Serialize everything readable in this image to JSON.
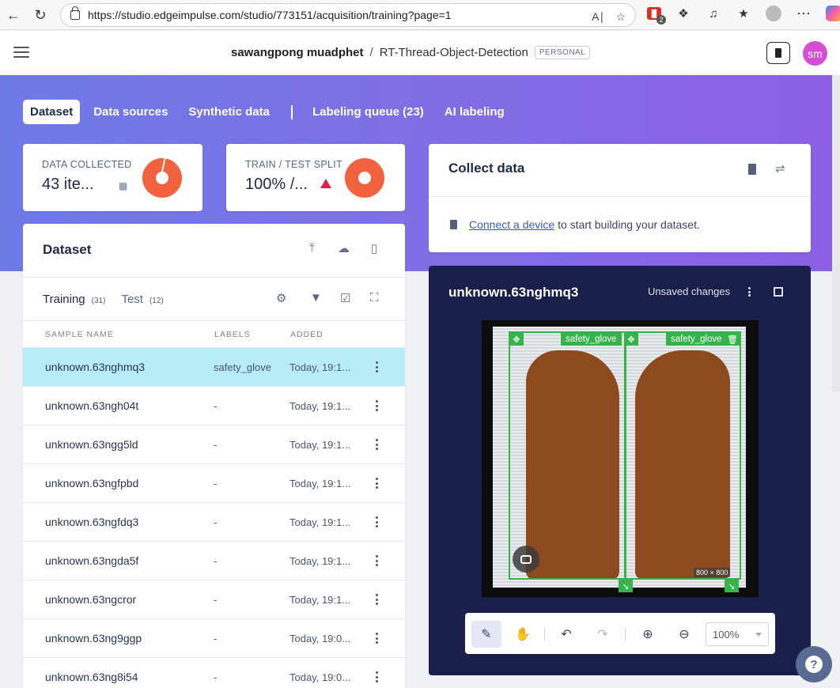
{
  "browser": {
    "url": "https://studio.edgeimpulse.com/studio/773151/acquisition/training?page=1",
    "ext_badge": "2"
  },
  "header": {
    "owner": "sawangpong muadphet",
    "separator": "/",
    "project": "RT-Thread-Object-Detection",
    "project_tag": "PERSONAL",
    "avatar_initials": "sm"
  },
  "tabs": [
    {
      "label": "Dataset",
      "active": true
    },
    {
      "label": "Data sources"
    },
    {
      "label": "Synthetic data"
    },
    {
      "label": "Labeling queue (23)"
    },
    {
      "label": "AI labeling"
    }
  ],
  "stats": {
    "collected": {
      "label": "DATA COLLECTED",
      "value": "43 ite..."
    },
    "split": {
      "label": "TRAIN / TEST SPLIT",
      "value": "100% /..."
    }
  },
  "collect": {
    "title": "Collect data",
    "link_text": "Connect a device",
    "rest_text": " to start building your dataset."
  },
  "dataset": {
    "title": "Dataset",
    "training_label": "Training",
    "training_count": "(31)",
    "test_label": "Test",
    "test_count": "(12)",
    "columns": [
      "SAMPLE NAME",
      "LABELS",
      "ADDED"
    ],
    "rows": [
      {
        "name": "unknown.63nghmq3",
        "label": "safety_glove",
        "added": "Today, 19:1...",
        "selected": true
      },
      {
        "name": "unknown.63ngh04t",
        "label": "-",
        "added": "Today, 19:1..."
      },
      {
        "name": "unknown.63ngg5ld",
        "label": "-",
        "added": "Today, 19:1..."
      },
      {
        "name": "unknown.63ngfpbd",
        "label": "-",
        "added": "Today, 19:1..."
      },
      {
        "name": "unknown.63ngfdq3",
        "label": "-",
        "added": "Today, 19:1..."
      },
      {
        "name": "unknown.63ngda5f",
        "label": "-",
        "added": "Today, 19:1..."
      },
      {
        "name": "unknown.63ngcror",
        "label": "-",
        "added": "Today, 19:1..."
      },
      {
        "name": "unknown.63ng9ggp",
        "label": "-",
        "added": "Today, 19:0..."
      },
      {
        "name": "unknown.63ng8i54",
        "label": "-",
        "added": "Today, 19:0..."
      }
    ]
  },
  "viewer": {
    "title": "unknown.63nghmq3",
    "status": "Unsaved changes",
    "box_labels": [
      "safety_glove",
      "safety_glove"
    ],
    "size_tag": "800 × 800",
    "zoom": "100%"
  },
  "colors": {
    "accent": "#7f6fe6",
    "selected_row": "#b8ecf7",
    "bbox": "#36b34a",
    "donut": "#f2623f",
    "viewer_bg": "#1a1f4a"
  }
}
